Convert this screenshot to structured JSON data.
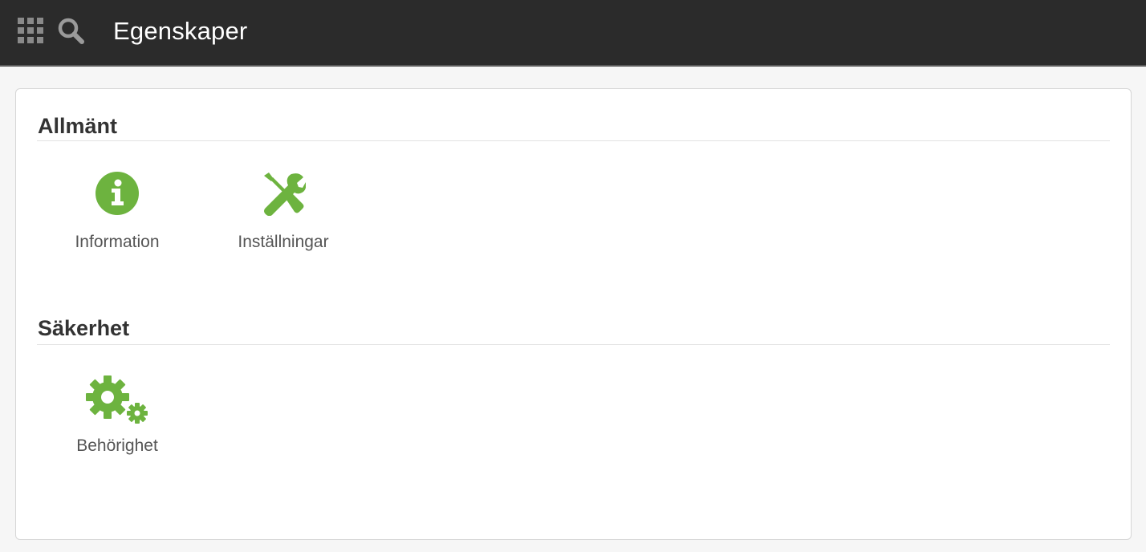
{
  "header": {
    "title": "Egenskaper",
    "apps_icon": "apps-grid-icon",
    "search_icon": "search-icon"
  },
  "theme": {
    "topbar_color": "#2b2b2b",
    "icon_green": "#6db33f"
  },
  "sections": [
    {
      "title": "Allmänt",
      "items": [
        {
          "label": "Information",
          "icon": "info-circle-icon"
        },
        {
          "label": "Inställningar",
          "icon": "tools-icon"
        }
      ]
    },
    {
      "title": "Säkerhet",
      "items": [
        {
          "label": "Behörighet",
          "icon": "gears-icon"
        }
      ]
    }
  ]
}
